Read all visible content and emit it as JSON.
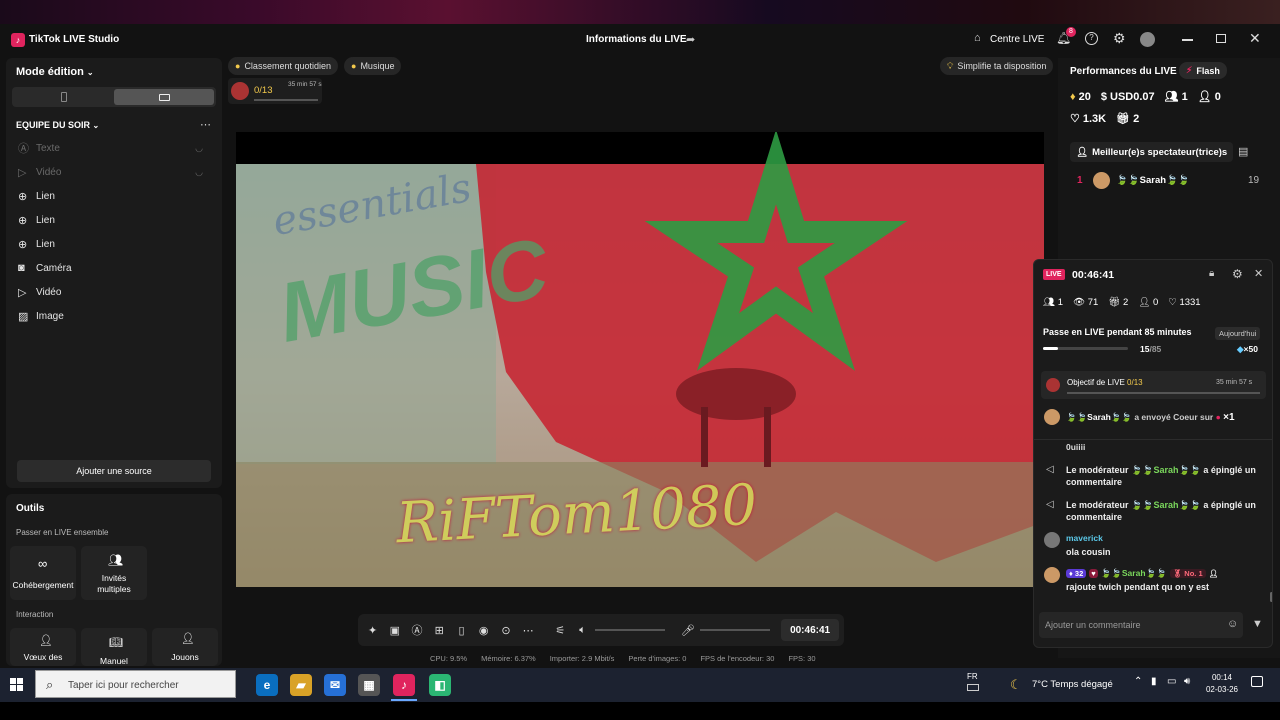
{
  "app": {
    "title": "TikTok LIVE Studio",
    "center_title": "Informations du LIVE",
    "centre_live": "Centre LIVE",
    "notif_count": "8"
  },
  "left": {
    "mode_edition": "Mode édition",
    "equipe": "EQUIPE DU SOIR",
    "sources": [
      {
        "label": "Texte",
        "icon": "text-icon",
        "dim": true
      },
      {
        "label": "Vidéo",
        "icon": "play-icon",
        "dim": true
      },
      {
        "label": "Lien",
        "icon": "globe-icon",
        "dim": false
      },
      {
        "label": "Lien",
        "icon": "globe-icon",
        "dim": false
      },
      {
        "label": "Lien",
        "icon": "globe-icon",
        "dim": false
      },
      {
        "label": "Caméra",
        "icon": "camera-icon",
        "dim": false
      },
      {
        "label": "Vidéo",
        "icon": "play-icon",
        "dim": false
      },
      {
        "label": "Image",
        "icon": "image-icon",
        "dim": false
      }
    ],
    "add_source": "Ajouter une source",
    "outils": "Outils",
    "passer": "Passer en LIVE ensemble",
    "cohebergement": "Cohébergement",
    "invites": "Invités multiples",
    "interaction": "Interaction",
    "voeux": "Vœux des",
    "manuel": "Manuel",
    "jouons": "Jouons"
  },
  "center": {
    "classement": "Classement quotidien",
    "musique": "Musique",
    "simplifie": "Simplifie ta disposition",
    "goal_count": "0/13",
    "goal_time": "35 min 57 s",
    "overlay_top": "essentials",
    "overlay_music": "MUSIC",
    "overlay_name": "RiFTom1080",
    "timer": "00:46:41"
  },
  "status": {
    "cpu": "CPU:  9.5%",
    "memoire": "Mémoire:  6.37%",
    "importer": "Importer:  2.9 Mbit/s",
    "perte": "Perte d'images:  0",
    "fps_enc": "FPS de l'encodeur:  30",
    "fps": "FPS:  30"
  },
  "right": {
    "performances": "Performances du LIVE",
    "flash": "Flash",
    "diamonds": "20",
    "usd": "USD0.07",
    "viewers": "1",
    "followers": "0",
    "likes": "1.3K",
    "gifts": "2",
    "top_viewers": "Meilleur(e)s spectateur(trice)s",
    "rank": "1",
    "top_name": "🍃🍃Sarah🍃🍃",
    "top_score": "19"
  },
  "popup": {
    "live_badge": "LIVE",
    "timer": "00:46:41",
    "viewers": "1",
    "views": "71",
    "gifts": "2",
    "followers": "0",
    "likes": "1331",
    "challenge": "Passe en LIVE pendant 85 minutes",
    "today": "Aujourd'hui",
    "progress": 0.176,
    "progress_current": "15",
    "progress_total": "/85",
    "reward": "×50",
    "objectif_label": "Objectif de LIVE ",
    "objectif_count": "0/13",
    "objectif_time": "35 min 57 s",
    "gift_name": "🍃🍃Sarah🍃🍃",
    "gift_text": " a envoyé Coeur sur ",
    "gift_count": "×1",
    "partial": "0uiiii",
    "mod1_a": "Le modérateur ",
    "mod1_name": "🍃🍃Sarah🍃🍃",
    "mod1_b": " a épinglé un commentaire",
    "mod2_a": "Le modérateur ",
    "mod2_name": "🍃🍃Sarah🍃🍃",
    "mod2_b": " a épinglé un commentaire",
    "maverick": "maverick",
    "maverick_msg": "ola cousin",
    "badge_level": "32",
    "sarah2": "🍃🍃Sarah🍃🍃",
    "no1": "No. 1",
    "sarah2_msg": "rajoute twich pendant qu on y est",
    "comment_placeholder": "Ajouter un commentaire"
  },
  "taskbar": {
    "search_placeholder": "Taper ici pour rechercher",
    "lang": "FR",
    "weather": "7°C  Temps dégagé",
    "time": "00:14",
    "date": "02-03-26"
  }
}
